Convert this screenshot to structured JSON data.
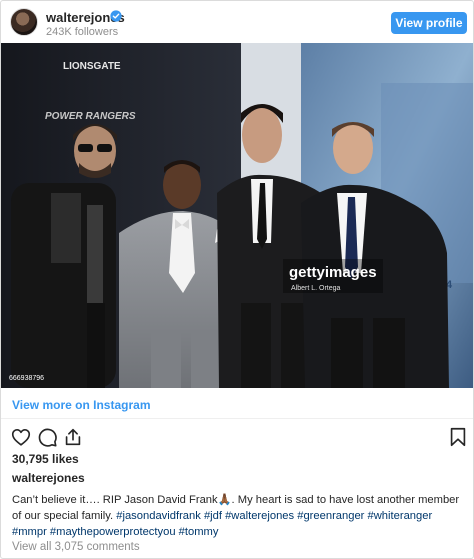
{
  "header": {
    "username": "walterejones",
    "followers": "243K followers",
    "view_profile_label": "View profile"
  },
  "photo": {
    "backdrop_text": [
      "LIONSGATE",
      "POWER RANGERS"
    ],
    "watermark": "gettyimages",
    "photographer": "Albert L. Ortega",
    "image_id": "666938796",
    "corner_text": "CH 24"
  },
  "view_more_label": "View more on Instagram",
  "likes": "30,795 likes",
  "owner": "walterejones",
  "caption": {
    "text": "Can’t believe it…. RIP Jason David Frank🙏🏾. My heart is sad to have lost another member of our special family.",
    "tags": "#jasondavidfrank #jdf #walterejones #greenranger #whiteranger #mmpr #maythepowerprotectyou #tommy"
  },
  "comments_link": "View all 3,075 comments",
  "colors": {
    "accent": "#3897f0",
    "hashtag": "#00376b",
    "muted": "#8e8e8e"
  },
  "icons": [
    "heart-icon",
    "comment-icon",
    "share-icon",
    "bookmark-icon",
    "verified-badge-icon"
  ]
}
